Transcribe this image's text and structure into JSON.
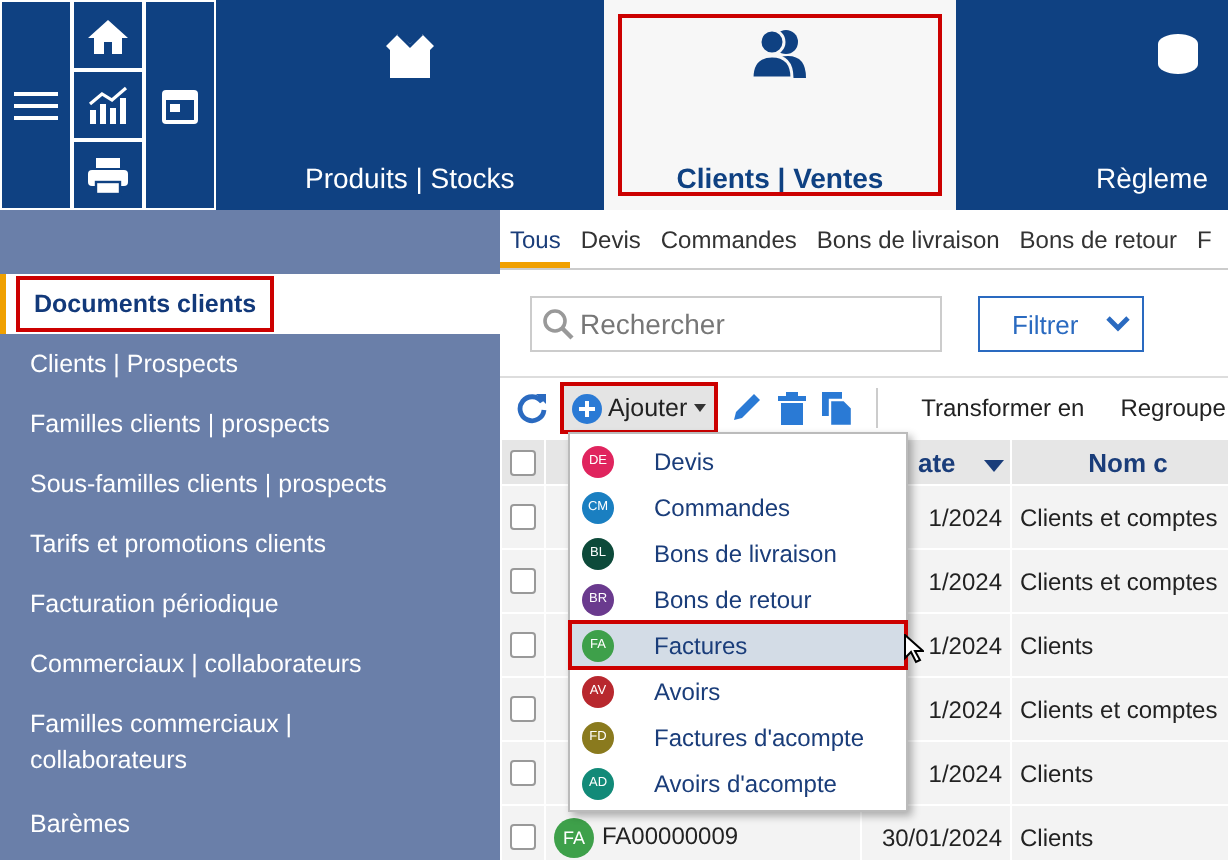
{
  "top_bar": {
    "modules": [
      {
        "kind": "products",
        "label": "Produits | Stocks",
        "selected": false,
        "highlighted": false
      },
      {
        "kind": "clients",
        "label": "Clients | Ventes",
        "selected": true,
        "highlighted": true
      },
      {
        "kind": "payments",
        "label": "Règleme",
        "selected": false,
        "highlighted": false
      }
    ]
  },
  "sidebar": {
    "items": [
      {
        "label": "Documents clients",
        "selected": true,
        "highlighted": true
      },
      {
        "label": "Clients | Prospects",
        "selected": false,
        "highlighted": false
      },
      {
        "label": "Familles clients | prospects",
        "selected": false,
        "highlighted": false
      },
      {
        "label": "Sous-familles clients | prospects",
        "selected": false,
        "highlighted": false
      },
      {
        "label": "Tarifs et promotions clients",
        "selected": false,
        "highlighted": false
      },
      {
        "label": "Facturation périodique",
        "selected": false,
        "highlighted": false
      },
      {
        "label": "Commerciaux | collaborateurs",
        "selected": false,
        "highlighted": false
      },
      {
        "label": "Familles commerciaux | collaborateurs",
        "selected": false,
        "highlighted": false
      },
      {
        "label": "Barèmes",
        "selected": false,
        "highlighted": false
      }
    ]
  },
  "document_tabs": [
    {
      "label": "Tous",
      "selected": true
    },
    {
      "label": "Devis",
      "selected": false
    },
    {
      "label": "Commandes",
      "selected": false
    },
    {
      "label": "Bons de livraison",
      "selected": false
    },
    {
      "label": "Bons de retour",
      "selected": false
    },
    {
      "label": "F",
      "selected": false
    }
  ],
  "search": {
    "placeholder": "Rechercher"
  },
  "filter_button": {
    "label": "Filtrer"
  },
  "toolbar": {
    "add_button": {
      "label": "Ajouter",
      "highlighted": true
    },
    "actions": [
      "Transformer en",
      "Regroupe"
    ]
  },
  "table": {
    "header_checked": false,
    "columns": [
      {
        "kind": "date",
        "label": "ate",
        "sorted": true
      },
      {
        "kind": "name",
        "label": "Nom c",
        "sorted": false
      }
    ],
    "rows": [
      {
        "checked": false,
        "date": "1/2024",
        "name": "Clients et comptes"
      },
      {
        "checked": false,
        "date": "1/2024",
        "name": "Clients et comptes"
      },
      {
        "checked": false,
        "date": "1/2024",
        "name": "Clients"
      },
      {
        "checked": false,
        "date": "1/2024",
        "name": "Clients et comptes"
      },
      {
        "checked": false,
        "date": "1/2024",
        "name": "Clients"
      },
      {
        "checked": false,
        "badge": "FA",
        "color": "#3ea04a",
        "reference": "FA00000009",
        "date": "30/01/2024",
        "name": "Clients"
      }
    ]
  },
  "add_menu": {
    "items": [
      {
        "badge": "DE",
        "label": "Devis",
        "color": "#e0245e",
        "selected": false,
        "highlighted": false
      },
      {
        "badge": "CM",
        "label": "Commandes",
        "color": "#1a7fc1",
        "selected": false,
        "highlighted": false
      },
      {
        "badge": "BL",
        "label": "Bons de livraison",
        "color": "#0d4a3a",
        "selected": false,
        "highlighted": false
      },
      {
        "badge": "BR",
        "label": "Bons de retour",
        "color": "#6a3a8e",
        "selected": false,
        "highlighted": false
      },
      {
        "badge": "FA",
        "label": "Factures",
        "color": "#3ea04a",
        "selected": true,
        "highlighted": true
      },
      {
        "badge": "AV",
        "label": "Avoirs",
        "color": "#b8282e",
        "selected": false,
        "highlighted": false
      },
      {
        "badge": "FD",
        "label": "Factures d'acompte",
        "color": "#8a7a1e",
        "selected": false,
        "highlighted": false
      },
      {
        "badge": "AD",
        "label": "Avoirs d'acompte",
        "color": "#128a78",
        "selected": false,
        "highlighted": false
      }
    ]
  }
}
